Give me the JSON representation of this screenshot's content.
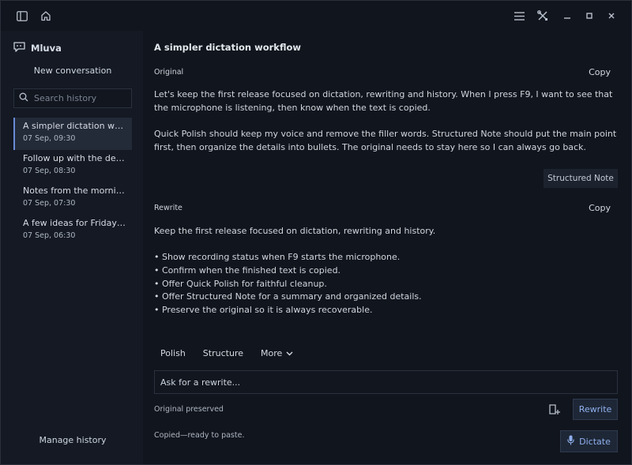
{
  "app": {
    "name": "Mluva",
    "icons": {
      "sidebar_toggle": "sidebar-toggle-icon",
      "home": "home-icon",
      "menu": "menu-icon",
      "tools": "tools-icon",
      "minimize": "minimize-icon",
      "maximize": "maximize-icon",
      "close": "close-icon"
    }
  },
  "sidebar": {
    "new_conversation": "New conversation",
    "search_placeholder": "Search history",
    "conversations": [
      {
        "title": "A simpler dictation workflow",
        "time": "07 Sep, 09:30",
        "active": true
      },
      {
        "title": "Follow up with the design team",
        "time": "07 Sep, 08:30",
        "active": false
      },
      {
        "title": "Notes from the morning meeting",
        "time": "07 Sep, 07:30",
        "active": false
      },
      {
        "title": "A few ideas for Friday's review",
        "time": "07 Sep, 06:30",
        "active": false
      }
    ],
    "manage_history": "Manage history"
  },
  "main": {
    "title": "A simpler dictation workflow",
    "original": {
      "label": "Original",
      "copy": "Copy",
      "para1": "Let's keep the first release focused on dictation, rewriting and history. When I press F9, I want to see that the microphone is listening, then know when the text is copied.",
      "para2": "Quick Polish should keep my voice and remove the filler words. Structured Note should put the main point first, then organize the details into bullets. The original needs to stay here so I can always go back."
    },
    "mode_chip": "Structured Note",
    "rewrite": {
      "label": "Rewrite",
      "copy": "Copy",
      "intro": "Keep the first release focused on dictation, rewriting and history.",
      "bullets": [
        "• Show recording status when F9 starts the microphone.",
        "• Confirm when the finished text is copied.",
        "• Offer Quick Polish for faithful cleanup.",
        "• Offer Structured Note for a summary and organized details.",
        "• Preserve the original so it is always recoverable."
      ]
    },
    "actions": {
      "polish": "Polish",
      "structure": "Structure",
      "more": "More"
    },
    "rewrite_placeholder": "Ask for a rewrite...",
    "status_preserved": "Original preserved",
    "rewrite_button": "Rewrite",
    "status_copied": "Copied—ready to paste.",
    "dictate_button": "Dictate"
  },
  "colors": {
    "background": "#11151d",
    "sidebar": "#141923",
    "accent": "#6a8bd8",
    "button_text": "#8fb0ee"
  }
}
